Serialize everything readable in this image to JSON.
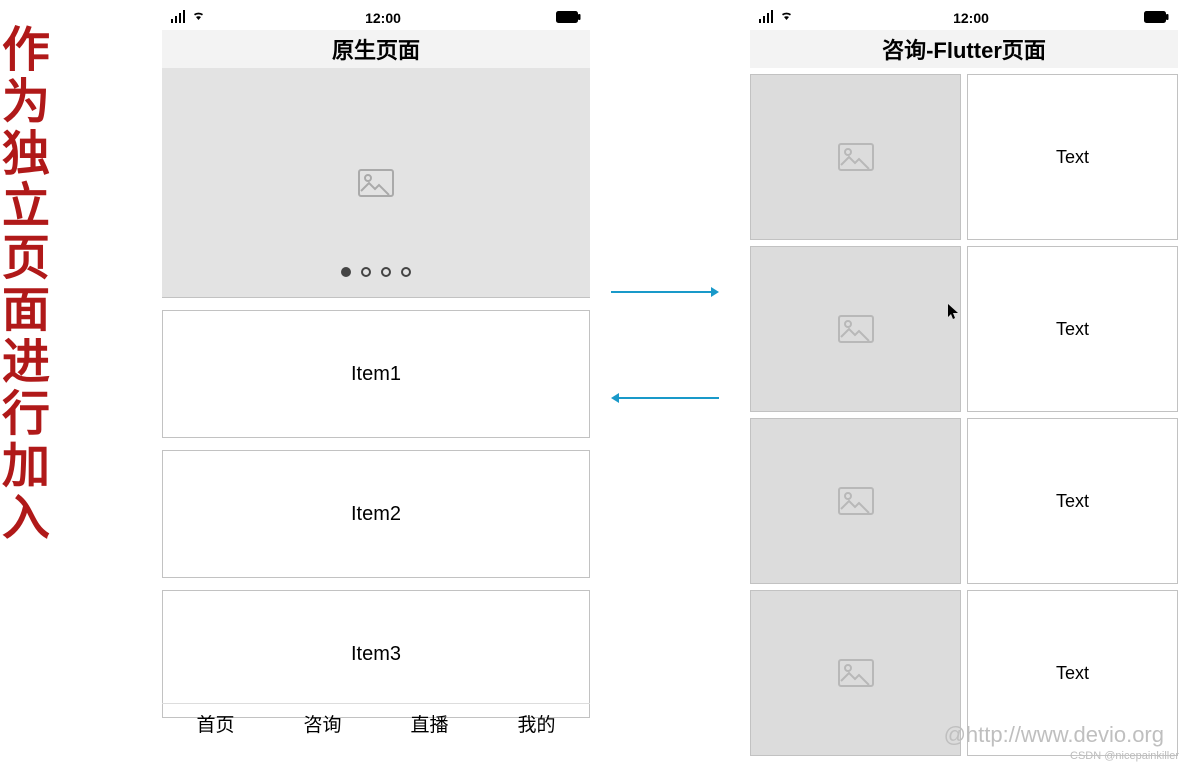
{
  "sidebar_text": "作为独立页面进行加入",
  "status_time": "12:00",
  "left_phone": {
    "title": "原生页面",
    "items": [
      "Item1",
      "Item2",
      "Item3"
    ],
    "tabs": [
      "首页",
      "咨询",
      "直播",
      "我的"
    ]
  },
  "right_phone": {
    "title": "咨询-Flutter页面",
    "rows": [
      "Text",
      "Text",
      "Text",
      "Text"
    ]
  },
  "watermark_url": "@http://www.devio.org",
  "watermark_csdn": "CSDN @nicepainkiller",
  "colors": {
    "red": "#b01919",
    "arrow": "#1999c9",
    "gray": "#e3e3e3"
  }
}
